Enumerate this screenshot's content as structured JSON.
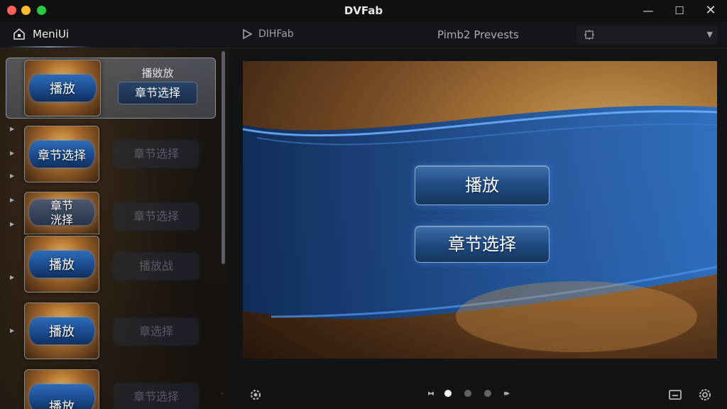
{
  "window": {
    "title": "DVFab",
    "controls": {
      "minimize": "—",
      "maximize": "☐",
      "close": "✕"
    }
  },
  "header": {
    "menu_title": "MeniUi",
    "brand": "DIHFab",
    "presets_label": "Pimb2 Prevests",
    "preset_value": ""
  },
  "sidebar": {
    "selected_row": {
      "thumb_label": "播放",
      "sub_title": "播敓放",
      "sub_button": "章节选择"
    },
    "rows": [
      {
        "thumb_label": "章节选择",
        "ghost_label": "章节选择"
      },
      {
        "thumb_label_line1": "章节",
        "thumb_label_line2": "洸择",
        "ghost_label": "章节选择"
      },
      {
        "thumb_label": "播放",
        "ghost_label": "播放战"
      },
      {
        "thumb_label": "播放",
        "ghost_label": "章选择"
      },
      {
        "thumb_label": "播放",
        "ghost_label": "章节选择"
      }
    ]
  },
  "preview": {
    "play_label": "播放",
    "chapter_label": "章节选择"
  },
  "pager": {
    "prev": "▶▎",
    "next": "▶▎",
    "pages": 3,
    "active_page": 1
  },
  "colors": {
    "accent_blue": "#1f4a82",
    "gold": "#c98f45"
  },
  "icons": {
    "home": "home-icon",
    "brand": "play-logo-icon",
    "preset": "settings-icon",
    "gear": "gear-icon",
    "screen": "screen-icon"
  }
}
